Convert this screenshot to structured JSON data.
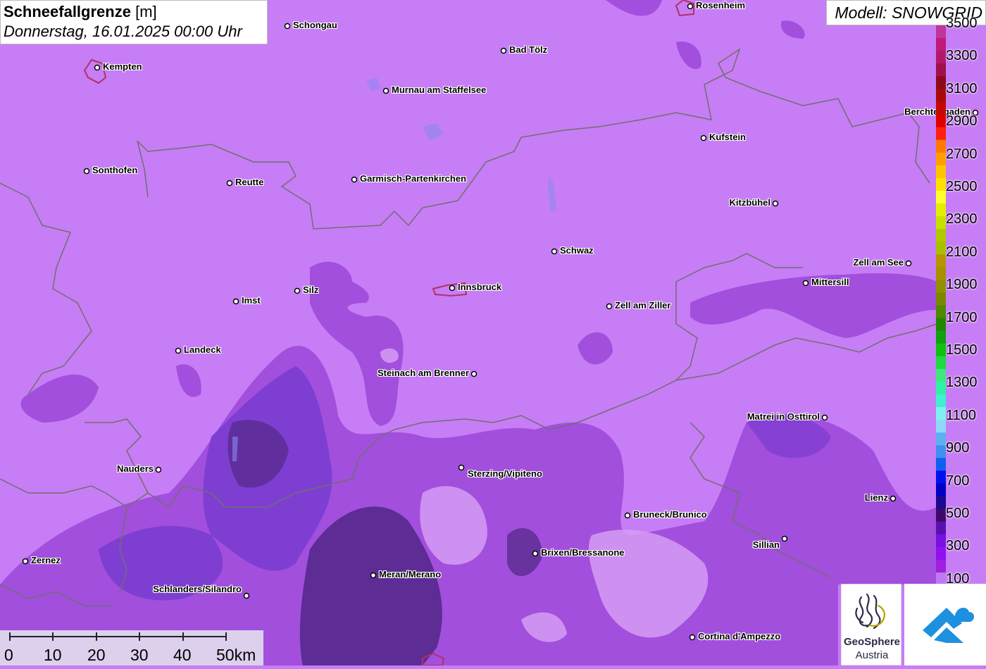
{
  "title": {
    "main": "Schneefallgrenze",
    "unit": "[m]",
    "subtitle": "Donnerstag, 16.01.2025 00:00 Uhr"
  },
  "model_label": "Modell: SNOWGRID",
  "places": [
    {
      "name": "Rosenheim"
    },
    {
      "name": "Schongau"
    },
    {
      "name": "Kempten"
    },
    {
      "name": "Bad Tölz"
    },
    {
      "name": "Murnau am Staffelsee"
    },
    {
      "name": "Berchtesgaden"
    },
    {
      "name": "Kufstein"
    },
    {
      "name": "Sonthofen"
    },
    {
      "name": "Reutte"
    },
    {
      "name": "Garmisch-Partenkirchen"
    },
    {
      "name": "Kitzbühel"
    },
    {
      "name": "Schwaz"
    },
    {
      "name": "Zell am See"
    },
    {
      "name": "Mittersill"
    },
    {
      "name": "Silz"
    },
    {
      "name": "Imst"
    },
    {
      "name": "Innsbruck"
    },
    {
      "name": "Zell am Ziller"
    },
    {
      "name": "Landeck"
    },
    {
      "name": "Steinach am Brenner"
    },
    {
      "name": "Matrei in Osttirol"
    },
    {
      "name": "Nauders"
    },
    {
      "name": "Sterzing/Vipiteno"
    },
    {
      "name": "Lienz"
    },
    {
      "name": "Bruneck/Brunico"
    },
    {
      "name": "Sillian"
    },
    {
      "name": "Brixen/Bressanone"
    },
    {
      "name": "Zernez"
    },
    {
      "name": "Meran/Merano"
    },
    {
      "name": "Schlanders/Silandro"
    },
    {
      "name": "Cortina d'Ampezzo"
    }
  ],
  "legend": {
    "ticks": [
      "3500",
      "3300",
      "3100",
      "2900",
      "2700",
      "2500",
      "2300",
      "2100",
      "1900",
      "1700",
      "1500",
      "1300",
      "1100",
      "900",
      "700",
      "500",
      "300",
      "100"
    ],
    "colors": [
      "#c0359b",
      "#c01a7a",
      "#b2186a",
      "#a0104a",
      "#8b0a1a",
      "#a80a0a",
      "#c40808",
      "#e00000",
      "#ff2010",
      "#ff7a00",
      "#ffa000",
      "#ffc400",
      "#ffe000",
      "#ffff30",
      "#e0f000",
      "#c8e000",
      "#b0c800",
      "#a8c000",
      "#b89400",
      "#a89000",
      "#909000",
      "#7a8800",
      "#508800",
      "#208800",
      "#10a010",
      "#10c010",
      "#20d840",
      "#40e880",
      "#30f0a8",
      "#40f0d0",
      "#80f0f0",
      "#90d8f8",
      "#60b0f0",
      "#4090f0",
      "#1060f0",
      "#0010f0",
      "#0000c0",
      "#1a0a90",
      "#40086a",
      "#5a10b0",
      "#7a10e0",
      "#9010f0",
      "#a020e0",
      "#c07af0"
    ]
  },
  "scale": {
    "labels": [
      "0",
      "10",
      "20",
      "30",
      "40",
      "50km"
    ]
  },
  "logos": {
    "geosphere_line1": "GeoSphere",
    "geosphere_line2": "Austria"
  },
  "colors": {
    "base_snowline": "#c77df5",
    "mid_snowline": "#9b46d8",
    "low_snowline": "#7a3cd0",
    "lowest_snowline": "#5a2a90",
    "high_area": "#d69bf5",
    "border": "#6f6f6f",
    "city_outline": "#b0306a"
  }
}
